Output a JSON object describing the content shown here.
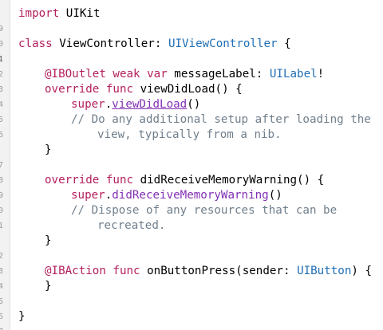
{
  "editor": {
    "line_numbers": [
      "9",
      "0",
      "1",
      "2",
      "3",
      "4",
      "5",
      "6",
      "",
      "7",
      "8",
      "9",
      "0",
      "1",
      "",
      "2",
      "3",
      "4",
      "5",
      "6",
      "7"
    ],
    "lines": {
      "import": {
        "kw": "import",
        "rest": " UIKit"
      },
      "class": {
        "kw": "class",
        "name": " ViewController: ",
        "type": "UIViewController",
        "rest": " {"
      },
      "outlet": {
        "attr": "@IBOutlet",
        "kw": " weak var",
        "name": " messageLabel: ",
        "type": "UILabel",
        "rest": "!"
      },
      "viewdidload": {
        "kw": "override func",
        "rest": " viewDidLoad() {"
      },
      "super1": {
        "kw": "super",
        "dot": ".",
        "call": "viewDidLoad",
        "rest": "()"
      },
      "comment1a": "// Do any additional setup after loading the",
      "comment1b": "view, typically from a nib.",
      "close1": "}",
      "memwarn": {
        "kw": "override func",
        "rest": " didReceiveMemoryWarning() {"
      },
      "super2": {
        "kw": "super",
        "dot": ".",
        "call": "didReceiveMemoryWarning",
        "rest": "()"
      },
      "comment2a": "// Dispose of any resources that can be",
      "comment2b": "recreated.",
      "close2": "}",
      "action": {
        "attr": "@IBAction",
        "kw": " func",
        "name": " onButtonPress(sender: ",
        "type": "UIButton",
        "rest": ") {"
      },
      "close3": "}",
      "close4": "}"
    }
  },
  "colors": {
    "keyword": "#b4205e",
    "type": "#1f6fb4",
    "comment": "#707f8c",
    "call": "#8230b4"
  }
}
